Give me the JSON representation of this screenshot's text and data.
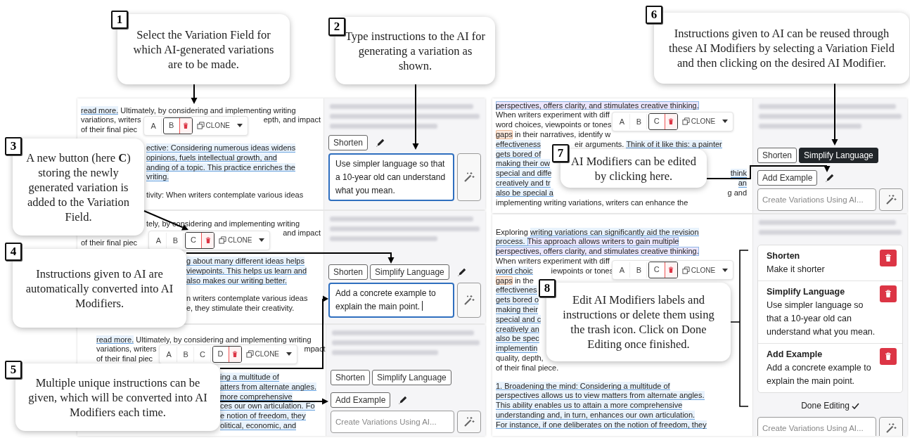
{
  "callouts": [
    {
      "number": "1",
      "text": "Select the Variation Field for which AI-generated variations are to be made."
    },
    {
      "number": "2",
      "text": "Type instructions to the AI for generating a variation as shown."
    },
    {
      "number": "3",
      "text": "A new button (here **C**) storing the newly generated variation is added to the Variation Field."
    },
    {
      "number": "4",
      "text": "Instructions given to AI are automatically converted into AI Modifiers."
    },
    {
      "number": "5",
      "text": "Multiple unique instructions can be given, which will be converted into AI Modifiers each time."
    },
    {
      "number": "6",
      "text": "Instructions given to AI can be reused through these AI Modifiers by selecting a Variation Field and then clicking on the desired AI Modifier."
    },
    {
      "number": "7",
      "text": "AI Modifiers can be edited by clicking here."
    },
    {
      "number": "8",
      "text": "Edit AI Modifiers labels and instructions or delete them using the trash icon. Click on Done Editing once finished."
    }
  ],
  "panels": [
    {
      "paragraphs": [
        {
          "lines": [
            {
              "parts": [
                {
                  "kind": "field",
                  "text": "read more."
                },
                {
                  "kind": "plain",
                  "text": " Ultimately, by considering and implementing writing"
                }
              ]
            },
            {
              "parts": [
                {
                  "kind": "plain",
                  "text": "variations, writers"
                },
                {
                  "kind": "gap"
                },
                {
                  "kind": "plain",
                  "text": "epth, and impact"
                }
              ]
            },
            {
              "parts": [
                {
                  "kind": "plain",
                  "text": "of their final piec"
                },
                {
                  "kind": "gap"
                }
              ]
            }
          ]
        },
        {
          "lines": [
            {
              "parts": [
                {
                  "kind": "cut"
                },
                {
                  "kind": "field",
                  "text": "ective: Considering numerous ideas widens"
                }
              ]
            },
            {
              "parts": [
                {
                  "kind": "cut"
                },
                {
                  "kind": "field",
                  "text": "opinions, fuels intellectual growth, and"
                }
              ]
            },
            {
              "parts": [
                {
                  "kind": "cut"
                },
                {
                  "kind": "field",
                  "text": "anding of a topic. This practice enriches the"
                }
              ]
            },
            {
              "parts": [
                {
                  "kind": "cut"
                },
                {
                  "kind": "field",
                  "text": "vriting."
                }
              ]
            }
          ]
        },
        {
          "lines": [
            {
              "parts": [
                {
                  "kind": "cut"
                },
                {
                  "kind": "plain",
                  "text": "tivity: When writers contemplate various ideas"
                }
              ]
            }
          ]
        }
      ],
      "toolbar": {
        "buttons": [
          {
            "label": "A",
            "selected": false
          },
          {
            "label": "B",
            "selected": true
          }
        ],
        "clone": "CLONE"
      },
      "ai": {
        "kind": "modifiers",
        "modifiers": [
          {
            "label": "Shorten",
            "selected": false
          }
        ],
        "prompt": {
          "value": "Use simpler language so that a 10-year old can understand what you mean.",
          "focused": true,
          "cursor": false
        }
      }
    },
    {
      "paragraphs": [
        {
          "lines": [
            {
              "parts": [
                {
                  "kind": "cut"
                },
                {
                  "kind": "plain",
                  "text": "tely, by considering and implementing writing"
                }
              ]
            },
            {
              "parts": [
                {
                  "kind": "cut"
                },
                {
                  "kind": "gap"
                },
                {
                  "kind": "plain",
                  "text": "and impact"
                }
              ]
            },
            {
              "parts": [
                {
                  "kind": "plain",
                  "text": "of their final piec"
                },
                {
                  "kind": "gap"
                }
              ]
            }
          ]
        },
        {
          "lines": [
            {
              "parts": [
                {
                  "kind": "cut"
                },
                {
                  "kind": "field",
                  "text": "g about many different ideas helps"
                }
              ]
            },
            {
              "parts": [
                {
                  "kind": "cut"
                },
                {
                  "kind": "field",
                  "text": "viewpoints. This helps us learn and"
                }
              ]
            },
            {
              "parts": [
                {
                  "kind": "cut"
                },
                {
                  "kind": "field",
                  "text": "also makes our writing better."
                }
              ]
            }
          ]
        },
        {
          "lines": [
            {
              "parts": [
                {
                  "kind": "cut"
                },
                {
                  "kind": "plain",
                  "text": "n writers contemplate various ideas"
                }
              ]
            },
            {
              "parts": [
                {
                  "kind": "cut"
                },
                {
                  "kind": "plain",
                  "text": "e, they stimulate their creativity."
                }
              ]
            }
          ]
        }
      ],
      "toolbar": {
        "buttons": [
          {
            "label": "A",
            "selected": false
          },
          {
            "label": "B",
            "selected": false
          },
          {
            "label": "C",
            "selected": true
          }
        ],
        "clone": "CLONE"
      },
      "ai": {
        "kind": "modifiers",
        "modifiers": [
          {
            "label": "Shorten",
            "selected": false
          },
          {
            "label": "Simplify Language",
            "selected": false
          }
        ],
        "prompt": {
          "value": "Add a concrete example to explain the main point.",
          "focused": true,
          "cursor": true
        }
      }
    },
    {
      "paragraphs": [
        {
          "lines": [
            {
              "parts": [
                {
                  "kind": "field",
                  "text": "read more."
                },
                {
                  "kind": "plain",
                  "text": " Ultimately, by considering and implementing writing"
                }
              ]
            },
            {
              "parts": [
                {
                  "kind": "plain",
                  "text": "variations, writers"
                },
                {
                  "kind": "gap"
                },
                {
                  "kind": "plain",
                  "text": "mpact"
                }
              ]
            },
            {
              "parts": [
                {
                  "kind": "plain",
                  "text": "of their final piec"
                },
                {
                  "kind": "gap"
                }
              ]
            }
          ]
        },
        {
          "lines": [
            {
              "parts": [
                {
                  "kind": "cut"
                },
                {
                  "kind": "field",
                  "text": "ing a multitude of"
                }
              ]
            },
            {
              "parts": [
                {
                  "kind": "cut"
                },
                {
                  "kind": "field",
                  "text": "atters from alternate angles."
                }
              ]
            },
            {
              "parts": [
                {
                  "kind": "cut"
                },
                {
                  "kind": "field",
                  "text": "more comprehensive"
                }
              ]
            },
            {
              "parts": [
                {
                  "kind": "cut"
                },
                {
                  "kind": "field",
                  "text": "ces our own articulation. Fo"
                }
              ]
            },
            {
              "parts": [
                {
                  "kind": "cut"
                },
                {
                  "kind": "field",
                  "text": "e notion of freedom, they"
                }
              ]
            },
            {
              "parts": [
                {
                  "kind": "cut"
                },
                {
                  "kind": "field",
                  "text": "olitical, economic, and"
                }
              ]
            }
          ]
        }
      ],
      "toolbar": {
        "buttons": [
          {
            "label": "A",
            "selected": false
          },
          {
            "label": "B",
            "selected": false
          },
          {
            "label": "C",
            "selected": false
          },
          {
            "label": "D",
            "selected": true
          }
        ],
        "clone": "CLONE"
      },
      "ai": {
        "kind": "modifiers",
        "modifiers": [
          {
            "label": "Shorten",
            "selected": false
          },
          {
            "label": "Simplify Language",
            "selected": false
          },
          {
            "label": "Add Example",
            "selected": false
          }
        ],
        "prompt": {
          "placeholder": "Create Variations Using AI...",
          "focused": false,
          "cursor": false
        }
      }
    },
    {
      "paragraphs": [
        {
          "lines": [
            {
              "parts": [
                {
                  "kind": "selected",
                  "text": "perspectives, offers clarity, and stimulates creative thinking."
                }
              ]
            },
            {
              "parts": [
                {
                  "kind": "plain",
                  "text": "When writers experiment with diff"
                },
                {
                  "kind": "gap"
                }
              ]
            },
            {
              "parts": [
                {
                  "kind": "plain",
                  "text": "word choices, viewpoints or tones"
                },
                {
                  "kind": "gap"
                }
              ]
            },
            {
              "parts": [
                {
                  "kind": "edited",
                  "text": "gaps"
                },
                {
                  "kind": "plain",
                  "text": " in their narratives, identify w"
                },
                {
                  "kind": "gap"
                }
              ]
            },
            {
              "parts": [
                {
                  "kind": "field",
                  "text": "effectiveness"
                },
                {
                  "kind": "cut"
                },
                {
                  "kind": "plain",
                  "text": "eir arguments. "
                },
                {
                  "kind": "field",
                  "text": "Think of it like this: a painter"
                }
              ]
            },
            {
              "parts": [
                {
                  "kind": "field",
                  "text": "gets bored of"
                }
              ]
            },
            {
              "parts": [
                {
                  "kind": "field",
                  "text": "making their ow"
                }
              ]
            },
            {
              "parts": [
                {
                  "kind": "field",
                  "text": "special and diffe"
                },
                {
                  "kind": "gap"
                },
                {
                  "kind": "field",
                  "text": "think"
                }
              ]
            },
            {
              "parts": [
                {
                  "kind": "field",
                  "text": "creatively and tr"
                },
                {
                  "kind": "gap"
                },
                {
                  "kind": "field",
                  "text": "an"
                }
              ]
            },
            {
              "parts": [
                {
                  "kind": "field",
                  "text": "also be special a"
                },
                {
                  "kind": "gap"
                },
                {
                  "kind": "plain",
                  "text": "g and"
                }
              ]
            },
            {
              "parts": [
                {
                  "kind": "plain",
                  "text": "implementing writing variations, writers can enhance the"
                }
              ]
            }
          ]
        }
      ],
      "toolbar": {
        "buttons": [
          {
            "label": "A",
            "selected": false
          },
          {
            "label": "B",
            "selected": false
          },
          {
            "label": "C",
            "selected": true
          }
        ],
        "clone": "CLONE"
      },
      "ai": {
        "kind": "modifiers",
        "modifiers": [
          {
            "label": "Shorten",
            "selected": false
          },
          {
            "label": "Simplify Language",
            "selected": true
          },
          {
            "label": "Add Example",
            "selected": false
          }
        ],
        "prompt": {
          "placeholder": "Create Variations Using AI...",
          "focused": false,
          "cursor": false
        }
      }
    },
    {
      "paragraphs": [
        {
          "lines": [
            {
              "parts": [
                {
                  "kind": "plain",
                  "text": "Exploring "
                },
                {
                  "kind": "field",
                  "text": "writing variations can significantly aid the revision"
                }
              ]
            },
            {
              "parts": [
                {
                  "kind": "field",
                  "text": "process. "
                },
                {
                  "kind": "selected",
                  "text": "This approach allows writers to gain multiple"
                }
              ]
            },
            {
              "parts": [
                {
                  "kind": "selected",
                  "text": "perspectives, offers clarity, and stimulates creative thinking."
                }
              ]
            },
            {
              "parts": [
                {
                  "kind": "plain",
                  "text": "When writers experiment with diff"
                },
                {
                  "kind": "gap"
                }
              ]
            },
            {
              "parts": [
                {
                  "kind": "field",
                  "text": "word choic"
                },
                {
                  "kind": "cut"
                },
                {
                  "kind": "plain",
                  "text": "iewpoints or tones"
                },
                {
                  "kind": "gap"
                }
              ]
            },
            {
              "parts": [
                {
                  "kind": "edited",
                  "text": "gaps"
                },
                {
                  "kind": "plain",
                  "text": " in the"
                }
              ]
            },
            {
              "parts": [
                {
                  "kind": "field",
                  "text": "effectivenes"
                }
              ]
            },
            {
              "parts": [
                {
                  "kind": "field",
                  "text": "gets bored o"
                }
              ]
            },
            {
              "parts": [
                {
                  "kind": "field",
                  "text": "making their"
                }
              ]
            },
            {
              "parts": [
                {
                  "kind": "field",
                  "text": "special and c"
                }
              ]
            },
            {
              "parts": [
                {
                  "kind": "field",
                  "text": "creatively an"
                }
              ]
            },
            {
              "parts": [
                {
                  "kind": "field",
                  "text": "also be spec"
                }
              ]
            },
            {
              "parts": [
                {
                  "kind": "field",
                  "text": "implementin"
                }
              ]
            },
            {
              "parts": [
                {
                  "kind": "plain",
                  "text": "quality, depth,"
                }
              ]
            },
            {
              "parts": [
                {
                  "kind": "plain",
                  "text": "of their final piece."
                }
              ]
            }
          ]
        },
        {
          "lines": [
            {
              "parts": [
                {
                  "kind": "field",
                  "text": "1. Broadening the mind: Considering a multitude of"
                }
              ]
            },
            {
              "parts": [
                {
                  "kind": "field",
                  "text": "perspectives allows us to view matters from alternate angles."
                }
              ]
            },
            {
              "parts": [
                {
                  "kind": "field",
                  "text": "This ability enables us to attain a more comprehensive"
                }
              ]
            },
            {
              "parts": [
                {
                  "kind": "field",
                  "text": "understanding and, in turn, enhances our own articulation."
                }
              ]
            },
            {
              "parts": [
                {
                  "kind": "field",
                  "text": "For instance, if one deliberates on the notion of freedom, they"
                }
              ]
            }
          ]
        }
      ],
      "toolbar": {
        "buttons": [
          {
            "label": "A",
            "selected": false
          },
          {
            "label": "B",
            "selected": false
          },
          {
            "label": "C",
            "selected": true
          }
        ],
        "clone": "CLONE"
      },
      "ai": {
        "kind": "editor",
        "items": [
          {
            "title": "Shorten",
            "instruction": "Make it shorter"
          },
          {
            "title": "Simplify Language",
            "instruction": "Use simpler language so that a 10-year old can understand what you mean."
          },
          {
            "title": "Add Example",
            "instruction": "Add a concrete example to explain the main point."
          }
        ],
        "done": "Done Editing",
        "prompt": {
          "placeholder": "Create Variations Using AI...",
          "focused": false,
          "cursor": false
        }
      }
    }
  ]
}
